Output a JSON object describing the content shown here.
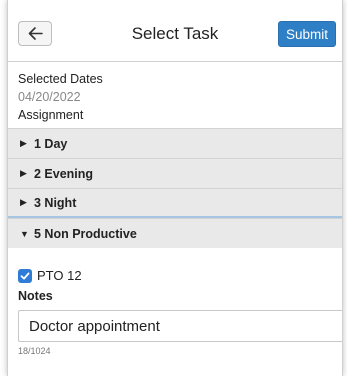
{
  "header": {
    "title": "Select Task",
    "submit_label": "Submit"
  },
  "info": {
    "selected_dates_label": "Selected Dates",
    "selected_date": "04/20/2022",
    "assignment_label": "Assignment"
  },
  "groups": [
    {
      "label": "1 Day",
      "expanded": false
    },
    {
      "label": "2 Evening",
      "expanded": false
    },
    {
      "label": "3 Night",
      "expanded": false
    },
    {
      "label": "5 Non Productive",
      "expanded": true
    }
  ],
  "task": {
    "label": "PTO 12",
    "checked": true
  },
  "notes": {
    "label": "Notes",
    "value": "Doctor appointment",
    "counter": "18/1024"
  },
  "colors": {
    "accent": "#2f7fc6",
    "group_bg": "#e9e9e9",
    "checkbox": "#2e7cd6"
  }
}
